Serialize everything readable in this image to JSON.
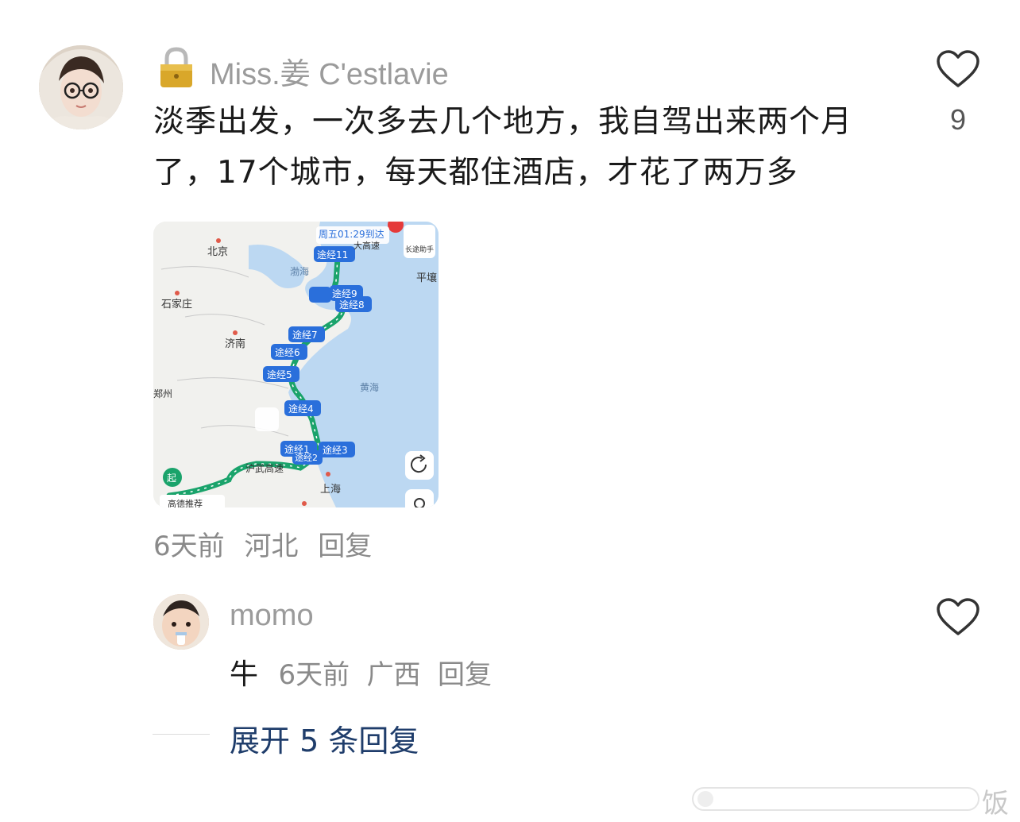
{
  "comment": {
    "username": "Miss.姜 C'estlavie",
    "text_line1": "淡季出发，一次多去几个地方，我自驾出来两个月",
    "text_line2": "了，17个城市，每天都住酒店，才花了两万多",
    "like_count": "9",
    "time": "6天前",
    "location": "河北",
    "reply_label": "回复",
    "lock_icon": "lock-icon",
    "like_icon": "heart-outline-icon"
  },
  "map": {
    "arrival": "周五01:29到达",
    "helper": "长途助手",
    "top_label": "…",
    "cities": {
      "beijing": "北京",
      "shijiazhuang": "石家庄",
      "jinan": "济南",
      "zhengzhou": "郑州",
      "shanghai": "上海",
      "pyongyang": "平壤"
    },
    "seas": {
      "bohai": "渤海",
      "huanghai": "黄海"
    },
    "waypoints": [
      "途经11",
      "途经9",
      "途经8",
      "途经7",
      "途经6",
      "途经5",
      "途经4",
      "途经3",
      "途经2",
      "途经1"
    ],
    "start_label": "起",
    "highway": "沪武高速",
    "highway_north": "大高速",
    "recommend": "高德推荐",
    "colors": {
      "route": "#1aa36b",
      "pin": "#2a6fdb",
      "sea": "#bcd8f2",
      "land": "#f0f0ee"
    }
  },
  "reply": {
    "username": "momo",
    "text": "牛",
    "time": "6天前",
    "location": "广西",
    "reply_label": "回复"
  },
  "expand": {
    "label": "展开 5 条回复"
  },
  "watermark": {
    "text": "饭"
  }
}
